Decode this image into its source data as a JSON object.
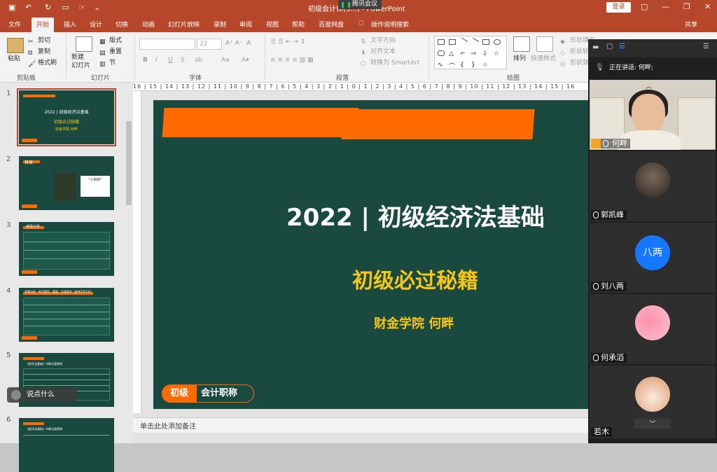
{
  "window": {
    "title": "初级会计师(3...) - PowerPoint",
    "meeting_tag": "腾讯会议",
    "login_label": "登录",
    "share_label": "共享"
  },
  "quick_access": [
    "save-icon",
    "undo-icon",
    "redo-icon",
    "present-icon",
    "touch-icon"
  ],
  "tabs": [
    "文件",
    "开始",
    "插入",
    "设计",
    "切换",
    "动画",
    "幻灯片放映",
    "录制",
    "审阅",
    "视图",
    "帮助",
    "百度网盘",
    "操作说明搜索"
  ],
  "ribbon": {
    "clipboard": {
      "paste": "粘贴",
      "cut": "剪切",
      "copy": "复制",
      "format_painter": "格式刷",
      "group": "剪贴板"
    },
    "slides": {
      "new_slide": "新建\n幻灯片",
      "layout": "版式",
      "reset": "重置",
      "section": "节",
      "group": "幻灯片"
    },
    "font": {
      "group": "字体",
      "size_placeholder": "22",
      "bold": "B",
      "italic": "I",
      "underline": "U",
      "strike": "S",
      "aa": "Aa"
    },
    "paragraph": {
      "text_direction": "文字方向",
      "align_text": "对齐文本",
      "smartart": "转换为 SmartArt",
      "group": "段落"
    },
    "drawing": {
      "arrange": "排列",
      "quick_styles": "快速样式",
      "fill": "形状填充",
      "outline": "形状轮廓",
      "effects": "形状效果",
      "group": "绘图"
    }
  },
  "ruler_text": "16 | 15 | 14 | 13 | 12 | 11 | 10 | 9 | 8 | 7 | 6 | 5 | 4 | 3 | 2 | 1 | 0 | 1 | 2 | 3 | 4 | 5 | 6 | 7 | 8 | 9 | 10 | 11 | 12 | 13 | 14 | 15 | 16",
  "thumbnails": [
    {
      "num": "1",
      "t1": "2022 | 初级经济法基础",
      "t2": "初级必过秘籍",
      "t3": "财金学院 何畔"
    },
    {
      "num": "2",
      "t1": "目录",
      "t2": "\"小目标\""
    },
    {
      "num": "3",
      "t1": "考情分析"
    },
    {
      "num": "4",
      "t1": "考情分析 · 考试题型、题量、分值要求（参考2021年）"
    },
    {
      "num": "5",
      "t1": "《经济法基础》书章分值预测"
    },
    {
      "num": "6",
      "t1": "《经济法基础》书章分值预测"
    }
  ],
  "slide": {
    "title": "2022 | 初级经济法基础",
    "subtitle": "初级必过秘籍",
    "author": "财金学院  何畔",
    "pill_left": "初级",
    "pill_right": "会计职称"
  },
  "notes_placeholder": "单击此处添加备注",
  "float_button": "说点什么",
  "meeting": {
    "speaking_label": "正在讲话: 何畔;",
    "participants": [
      {
        "name": "何畔",
        "type": "video"
      },
      {
        "name": "郭凯峰",
        "type": "photo"
      },
      {
        "name": "刘八两",
        "type": "initials",
        "initials": "八两",
        "color": "#1677ff"
      },
      {
        "name": "何承滔",
        "type": "photo"
      },
      {
        "name": "若木",
        "type": "photo"
      }
    ]
  }
}
